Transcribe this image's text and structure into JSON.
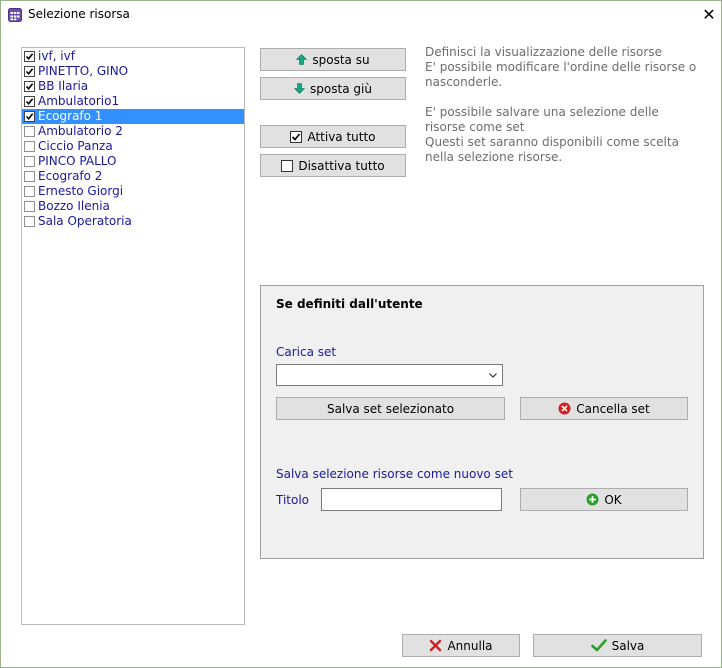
{
  "window": {
    "title": "Selezione risorsa",
    "app_icon": "calendar-grid-icon",
    "close_icon": "close-icon",
    "close_glyph": "✕"
  },
  "resources": [
    {
      "label": "ivf, ivf",
      "checked": true
    },
    {
      "label": "PINETTO, GINO",
      "checked": true
    },
    {
      "label": "BB Ilaria",
      "checked": true
    },
    {
      "label": "Ambulatorio1",
      "checked": true
    },
    {
      "label": "Ecografo 1",
      "checked": true,
      "selected": true
    },
    {
      "label": "Ambulatorio 2",
      "checked": false
    },
    {
      "label": "Ciccio Panza",
      "checked": false
    },
    {
      "label": "PINCO PALLO",
      "checked": false
    },
    {
      "label": "Ecografo 2",
      "checked": false
    },
    {
      "label": "Ernesto Giorgi",
      "checked": false
    },
    {
      "label": "Bozzo Ilenia",
      "checked": false
    },
    {
      "label": "Sala Operatoria",
      "checked": false
    }
  ],
  "buttons": {
    "move_up": "sposta su",
    "move_down": "sposta giù",
    "activate_all": "Attiva tutto",
    "deactivate_all": "Disattiva tutto",
    "save_selected_set": "Salva set selezionato",
    "delete_set": "Cancella set",
    "ok": "OK",
    "cancel": "Annulla",
    "save": "Salva"
  },
  "info": {
    "line1": "Definisci la visualizzazione delle risorse",
    "line2": "E' possibile modificare l'ordine delle risorse o",
    "line3": "nasconderle.",
    "line4": "E' possibile salvare una selezione delle",
    "line5": "risorse come set",
    "line6": "Questi set saranno disponibili come scelta",
    "line7": "nella selezione risorse."
  },
  "user_sets": {
    "title": "Se definiti dall'utente",
    "load_label": "Carica set",
    "load_value": "",
    "save_new_label": "Salva selezione risorse come nuovo set",
    "title_label": "Titolo",
    "title_value": ""
  },
  "colors": {
    "selection": "#3390ff",
    "label_blue": "#1a1aa0",
    "arrow_teal": "#1aa680",
    "ok_green": "#2aa02a",
    "cancel_red": "#d42020"
  }
}
